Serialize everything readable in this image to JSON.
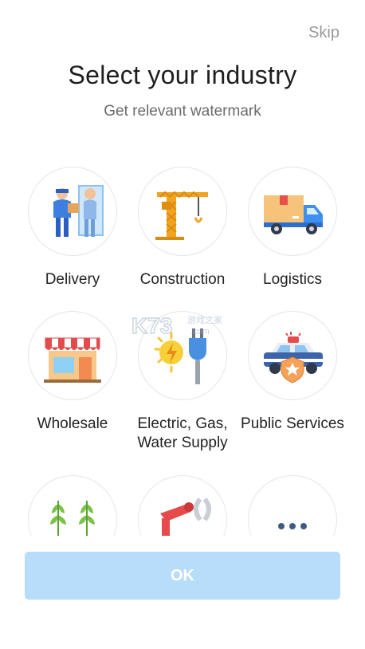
{
  "header": {
    "skip_label": "Skip",
    "title": "Select your industry",
    "subtitle": "Get relevant watermark"
  },
  "industries": [
    {
      "label": "Delivery",
      "icon": "delivery-icon"
    },
    {
      "label": "Construction",
      "icon": "crane-icon"
    },
    {
      "label": "Logistics",
      "icon": "truck-icon"
    },
    {
      "label": "Wholesale",
      "icon": "shop-icon"
    },
    {
      "label": "Electric, Gas,\nWater Supply",
      "icon": "plug-icon"
    },
    {
      "label": "Public Services",
      "icon": "police-car-icon"
    },
    {
      "label": "",
      "icon": "plants-icon"
    },
    {
      "label": "",
      "icon": "robot-arm-icon"
    },
    {
      "label": "",
      "icon": "more-icon"
    }
  ],
  "footer": {
    "ok_label": "OK"
  },
  "watermark": {
    "text_main": "K73",
    "text_cn": "游戏之家",
    "text_dom": ".com"
  },
  "colors": {
    "ok_background": "#b8ddfb",
    "skip_text": "#9a9a9a"
  }
}
